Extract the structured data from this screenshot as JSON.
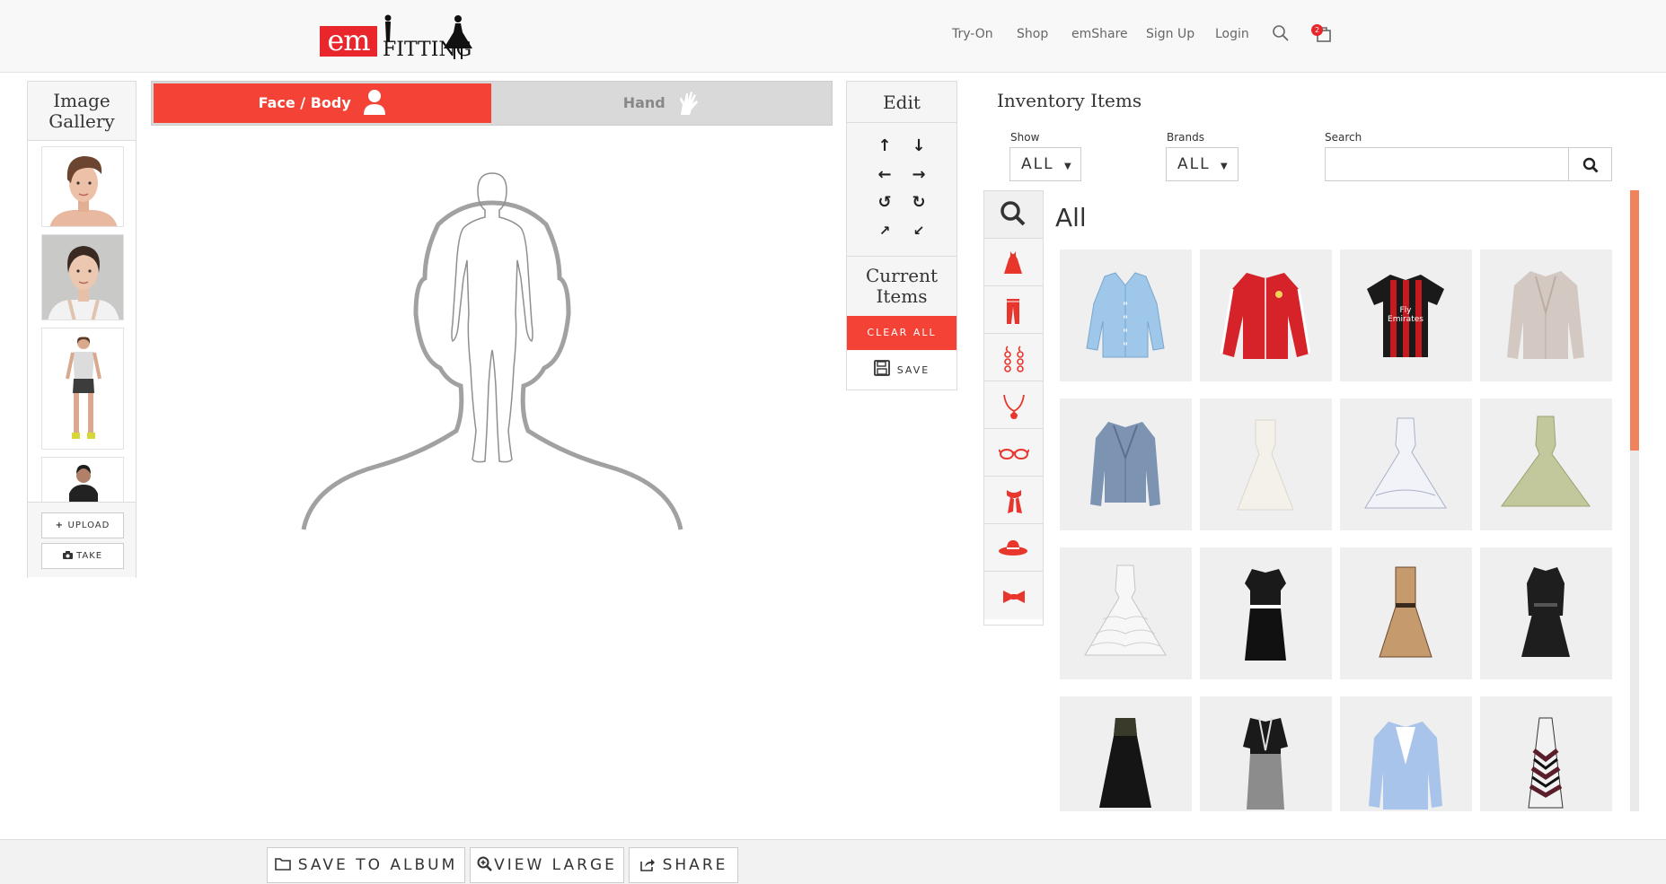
{
  "nav": {
    "logo_text": "em",
    "logo_word": "FITTING",
    "links": [
      "Try-On",
      "Shop",
      "emShare",
      "Sign Up",
      "Login"
    ],
    "cart_count": "2"
  },
  "gallery": {
    "title_line1": "Image",
    "title_line2": "Gallery",
    "upload_label": "UPLOAD",
    "take_label": "TAKE"
  },
  "tabs": {
    "face_body": "Face / Body",
    "hand": "Hand"
  },
  "edit": {
    "title": "Edit",
    "current_line1": "Current",
    "current_line2": "Items",
    "clear_all": "CLEAR ALL",
    "save": "SAVE"
  },
  "inventory": {
    "title": "Inventory Items",
    "show_label": "Show",
    "show_value": "ALL",
    "brands_label": "Brands",
    "brands_value": "ALL",
    "search_label": "Search",
    "search_value": "",
    "category_heading": "All",
    "categories": [
      "search-icon",
      "dress-icon",
      "pants-icon",
      "earrings-icon",
      "necklace-icon",
      "glasses-icon",
      "scarf-icon",
      "hat-icon",
      "bowtie-icon"
    ]
  },
  "bottom": {
    "save_album": "SAVE TO ALBUM",
    "view_large": "VIEW LARGE",
    "share": "SHARE"
  },
  "colors": {
    "accent": "#f44336",
    "logo_red": "#e8262b",
    "scrollbar": "#f0825c"
  }
}
